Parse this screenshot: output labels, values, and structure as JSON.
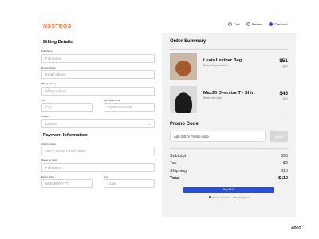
{
  "brand": {
    "logo": "NSSTEGS"
  },
  "steps": [
    {
      "label": "Cart",
      "state": "done"
    },
    {
      "label": "Review",
      "state": "done"
    },
    {
      "label": "Checkout",
      "state": "active"
    }
  ],
  "billing": {
    "title": "Billing Details",
    "full_name": {
      "label": "Full Name",
      "placeholder": "Full Name"
    },
    "email": {
      "label": "Email Adress",
      "placeholder": "Email adress"
    },
    "address": {
      "label": "Billing Adress",
      "placeholder": "Billing adress"
    },
    "city": {
      "label": "City",
      "placeholder": "City"
    },
    "zip": {
      "label": "Zip/Postal Code",
      "placeholder": "Zip/Postal code"
    },
    "country": {
      "label": "Country",
      "placeholder": "Country"
    }
  },
  "payment": {
    "title": "Payment Information",
    "card_number": {
      "label": "Card Number",
      "placeholder": "XXXX XXXX XXXX XXXX"
    },
    "card_name": {
      "label": "Name on Card",
      "placeholder": "Full Name"
    },
    "expiry": {
      "label": "Expiry Date",
      "placeholder": "MM/MM/YYYY"
    },
    "cvv": {
      "label": "Cvv",
      "placeholder": "Code"
    }
  },
  "order": {
    "title": "Order Summary",
    "items": [
      {
        "name": "Levis Leather Bag",
        "desc": "Brown Vegan Leather",
        "price": "$51",
        "qty": "Qty:1"
      },
      {
        "name": "Max90 Oversize T - Shirt",
        "desc": "Black linen cloth",
        "price": "$45",
        "qty": "Qty:1"
      }
    ],
    "promo_title": "Promo Code",
    "promo_placeholder": "Add Gift or Promo code",
    "apply_label": "Apply",
    "summary": [
      {
        "label": "Subtotal",
        "value": "$96"
      },
      {
        "label": "Tax",
        "value": "$4"
      },
      {
        "label": "Shipping",
        "value": "$10"
      }
    ],
    "total": {
      "label": "Total",
      "value": "$110"
    },
    "pay_label": "Pay $110",
    "secure_text": "Secure Checkout - SSL Encrypted"
  },
  "shot_number": "#002",
  "colors": {
    "accent": "#2a4fd6",
    "brand": "#f07a3c",
    "panel": "#f2f2f2"
  },
  "icons": {
    "chevron": "chevron-down-icon",
    "lock": "lock-icon"
  }
}
